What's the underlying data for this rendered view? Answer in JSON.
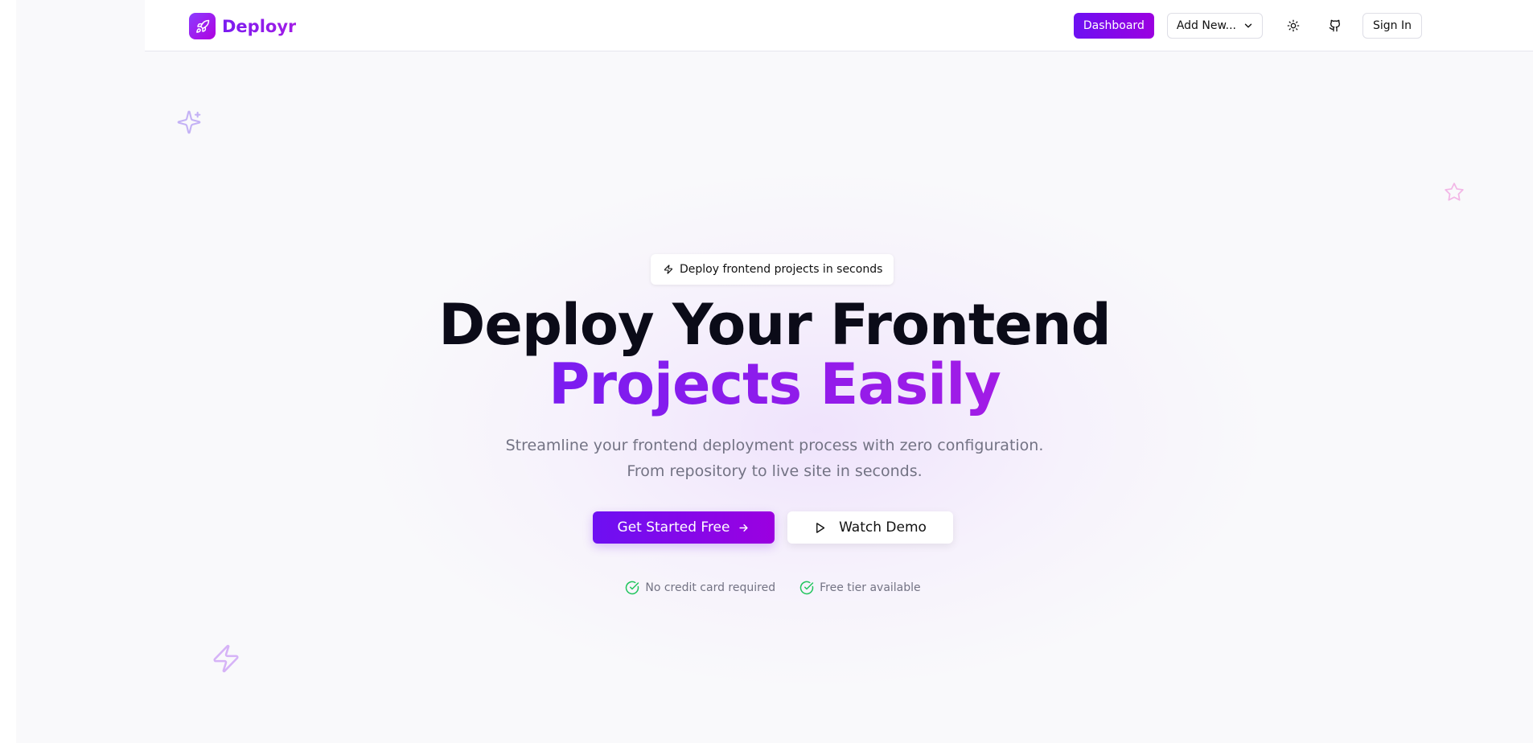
{
  "brand": {
    "name": "Deploy­r"
  },
  "nav": {
    "dashboard_label": "Dashboard",
    "add_new_label": "Add New...",
    "signin_label": "Sign In"
  },
  "hero": {
    "badge_text": "Deploy frontend projects in seconds",
    "title_line1": "Deploy Your Frontend",
    "title_line2": "Projects Easily",
    "subtitle_line1": "Streamline your frontend deployment process with zero configuration.",
    "subtitle_line2": "From repository to live site in seconds.",
    "primary_cta": "Get Started Free",
    "secondary_cta": "Watch Demo",
    "perks": [
      "No credit card required",
      "Free tier available"
    ]
  },
  "colors": {
    "accent_start": "#6d10f2",
    "accent_end": "#9b00e0",
    "success": "#22c55e",
    "muted_text": "#737384"
  },
  "icons": [
    "rocket-icon",
    "chevron-down-icon",
    "sun-icon",
    "github-icon",
    "sparkles-icon",
    "star-icon",
    "zap-icon",
    "arrow-right-icon",
    "play-icon",
    "check-circle-icon"
  ]
}
